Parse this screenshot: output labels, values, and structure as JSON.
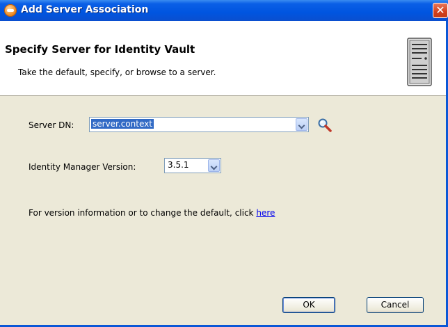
{
  "window": {
    "title": "Add Server Association",
    "close_icon": "close-icon"
  },
  "header": {
    "title": "Specify Server for Identity Vault",
    "description": "Take the default, specify, or browse to a server.",
    "icon": "server-icon"
  },
  "form": {
    "server_dn_label": "Server DN:",
    "server_dn_value": "server.context",
    "browse_icon": "search-icon",
    "version_label": "Identity Manager Version:",
    "version_value": "3.5.1",
    "info_text": "For version information or to change the default, click ",
    "info_link": "here"
  },
  "buttons": {
    "ok": "OK",
    "cancel": "Cancel"
  }
}
